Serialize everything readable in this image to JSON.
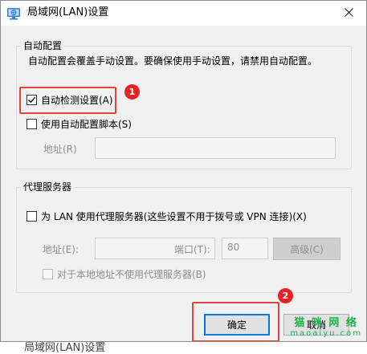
{
  "window": {
    "title": "局域网(LAN)设置"
  },
  "behind_window_title": "局域网(LAN)设置",
  "auto_config": {
    "group_label": "自动配置",
    "description": "自动配置会覆盖手动设置。要确保使用手动设置，请禁用自动配置。",
    "auto_detect_label": "自动检测设置(A)",
    "auto_detect_checked": true,
    "use_script_label": "使用自动配置脚本(S)",
    "use_script_checked": false,
    "address_label": "地址(R)",
    "address_value": ""
  },
  "proxy": {
    "group_label": "代理服务器",
    "use_proxy_label": "为 LAN 使用代理服务器(这些设置不用于拨号或 VPN 连接)(X)",
    "use_proxy_checked": false,
    "address_label": "地址(E):",
    "address_value": "",
    "port_label": "端口(T):",
    "port_value": "80",
    "advanced_label": "高级(C)",
    "bypass_label": "对于本地地址不使用代理服务器(B)",
    "bypass_checked": false
  },
  "buttons": {
    "ok": "确定",
    "cancel": "取消"
  },
  "annotations": {
    "step1": "1",
    "step2": "2"
  },
  "watermark": {
    "main": "猫 咪 网 络",
    "sub": "maoaiyu.com"
  },
  "colors": {
    "highlight": "#e0443e",
    "badge": "#e62222",
    "focus": "#0078d7",
    "watermark": "#19b34a"
  }
}
